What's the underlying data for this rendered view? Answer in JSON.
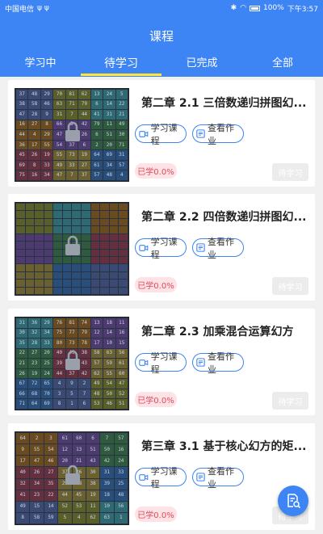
{
  "status_bar": {
    "carrier": "中国电信",
    "signal_icons": "ψ ψ",
    "battery": "100%",
    "time": "下午3:57"
  },
  "header": {
    "title": "课程"
  },
  "tabs": [
    {
      "label": "学习中"
    },
    {
      "label": "待学习",
      "active": true
    },
    {
      "label": "已完成"
    },
    {
      "label": "全部"
    }
  ],
  "courses": [
    {
      "title": "第二章 2.1 三倍数递归拼图幻...",
      "study_label": "学习课程",
      "homework_label": "查看作业",
      "progress_label": "已学0.0%",
      "status_label": "待学习",
      "thumb": {
        "cols": 9,
        "rows": 9,
        "numbers": [
          "37",
          "48",
          "29",
          "70",
          "81",
          "62",
          "13",
          "24",
          "5",
          "38",
          "58",
          "46",
          "63",
          "71",
          "79",
          "6",
          "14",
          "22",
          "47",
          "28",
          "9",
          "31",
          "7",
          "44",
          "41",
          "31",
          "21",
          "16",
          "27",
          "8",
          "66",
          "3",
          "42",
          "79",
          "11",
          "49",
          "44",
          "4",
          "29",
          "47",
          "61",
          "26",
          "6",
          "51",
          "30",
          "36",
          "17",
          "55",
          "54",
          "37",
          "6",
          "2",
          "20",
          "71",
          "45",
          "26",
          "19",
          "55",
          "73",
          "19",
          "64",
          "69",
          "31",
          "69",
          "8",
          "33",
          "49",
          "33",
          "27",
          "61",
          "34",
          "57",
          "75",
          "16",
          "34",
          "47",
          "7",
          "37",
          "57",
          "48",
          "4"
        ]
      }
    },
    {
      "title": "第二章 2.2 四倍数递归拼图幻...",
      "study_label": "学习课程",
      "homework_label": "查看作业",
      "progress_label": "已学0.0%",
      "status_label": "待学习",
      "thumb": {
        "cols": 12,
        "rows": 12,
        "numbers": []
      }
    },
    {
      "title": "第二章 2.3 加乘混合运算幻方",
      "study_label": "学习课程",
      "homework_label": "查看作业",
      "progress_label": "已学0.0%",
      "status_label": "待学习",
      "thumb": {
        "cols": 9,
        "rows": 9,
        "numbers": [
          "31",
          "36",
          "29",
          "76",
          "81",
          "74",
          "13",
          "18",
          "11",
          "30",
          "32",
          "34",
          "75",
          "77",
          "79",
          "12",
          "14",
          "16",
          "35",
          "28",
          "33",
          "80",
          "73",
          "78",
          "17",
          "10",
          "15",
          "22",
          "27",
          "20",
          "40",
          "45",
          "38",
          "58",
          "63",
          "56",
          "21",
          "23",
          "25",
          "39",
          "41",
          "43",
          "57",
          "59",
          "61",
          "26",
          "19",
          "24",
          "44",
          "37",
          "42",
          "62",
          "55",
          "60",
          "67",
          "72",
          "65",
          "4",
          "9",
          "2",
          "49",
          "54",
          "47",
          "66",
          "68",
          "70",
          "3",
          "5",
          "7",
          "48",
          "50",
          "52",
          "71",
          "64",
          "69",
          "8",
          "1",
          "6",
          "53",
          "46",
          "51"
        ]
      }
    },
    {
      "title": "第三章 3.1 基于核心幻方的矩...",
      "study_label": "学习课程",
      "homework_label": "查看作业",
      "progress_label": "已学0.0%",
      "status_label": "待学习",
      "thumb": {
        "cols": 8,
        "rows": 8,
        "numbers": [
          "64",
          "2",
          "3",
          "61",
          "60",
          "6",
          "7",
          "57",
          "9",
          "55",
          "54",
          "12",
          "13",
          "51",
          "50",
          "16",
          "17",
          "47",
          "46",
          "20",
          "21",
          "43",
          "42",
          "24",
          "40",
          "26",
          "27",
          "37",
          "36",
          "30",
          "31",
          "33",
          "32",
          "34",
          "35",
          "29",
          "28",
          "38",
          "39",
          "25",
          "41",
          "23",
          "22",
          "44",
          "45",
          "19",
          "18",
          "48",
          "49",
          "15",
          "14",
          "52",
          "53",
          "11",
          "10",
          "56",
          "8",
          "58",
          "59",
          "5",
          "4",
          "62",
          "63",
          "1"
        ]
      }
    }
  ],
  "fab": {
    "icon": "document-search-icon"
  },
  "colors": {
    "primary": "#3d84f5",
    "tab_indicator": "#ffe53b",
    "progress_bg": "#fde2e6",
    "progress_text": "#e04b5b"
  }
}
